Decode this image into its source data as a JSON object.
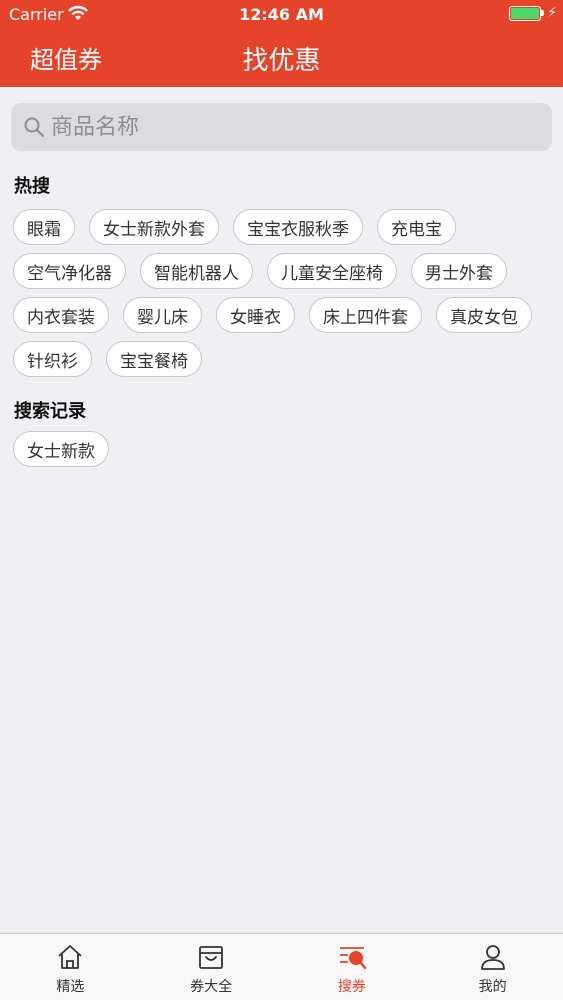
{
  "status_bar": {
    "carrier": "Carrier",
    "time": "12:46 AM"
  },
  "nav": {
    "left_label": "超值券",
    "title": "找优惠"
  },
  "search": {
    "placeholder": "商品名称"
  },
  "hot_search": {
    "title": "热搜",
    "tags": [
      "眼霜",
      "女士新款外套",
      "宝宝衣服秋季",
      "充电宝",
      "空气净化器",
      "智能机器人",
      "儿童安全座椅",
      "男士外套",
      "内衣套装",
      "婴儿床",
      "女睡衣",
      "床上四件套",
      "真皮女包",
      "针织衫",
      "宝宝餐椅"
    ]
  },
  "history": {
    "title": "搜索记录",
    "tags": [
      "女士新款"
    ]
  },
  "tabbar": {
    "tabs": [
      {
        "label": "精选",
        "icon": "home-icon"
      },
      {
        "label": "券大全",
        "icon": "bag-icon"
      },
      {
        "label": "搜券",
        "icon": "search-coupon-icon"
      },
      {
        "label": "我的",
        "icon": "user-icon"
      }
    ],
    "active_index": 2
  },
  "colors": {
    "brand": "#e5432a",
    "background": "#efeff4",
    "battery": "#4cd964"
  }
}
